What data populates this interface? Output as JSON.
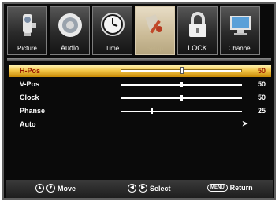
{
  "tabs": [
    {
      "label": "Picture",
      "icon": "camcorder-icon",
      "active": false
    },
    {
      "label": "Audio",
      "icon": "speaker-icon",
      "active": false
    },
    {
      "label": "Time",
      "icon": "clock-icon",
      "active": false
    },
    {
      "label": "Setup",
      "icon": "tools-icon",
      "active": true
    },
    {
      "label": "LOCK",
      "icon": "padlock-icon",
      "active": false
    },
    {
      "label": "Channel",
      "icon": "monitor-icon",
      "active": false
    }
  ],
  "settings": [
    {
      "label": "H-Pos",
      "value": "50",
      "level": 50,
      "selected": true
    },
    {
      "label": "V-Pos",
      "value": "50",
      "level": 50
    },
    {
      "label": "Clock",
      "value": "50",
      "level": 50
    },
    {
      "label": "Phanse",
      "value": "25",
      "level": 25
    },
    {
      "label": "Auto",
      "arrow": "➤"
    }
  ],
  "footer": {
    "move_label": "Move",
    "select_label": "Select",
    "menu_key": "MENU",
    "return_label": "Return"
  },
  "colors": {
    "selected_row": "#f2c446",
    "selected_text": "#9a1a00",
    "active_tab": "#cbbb97"
  }
}
